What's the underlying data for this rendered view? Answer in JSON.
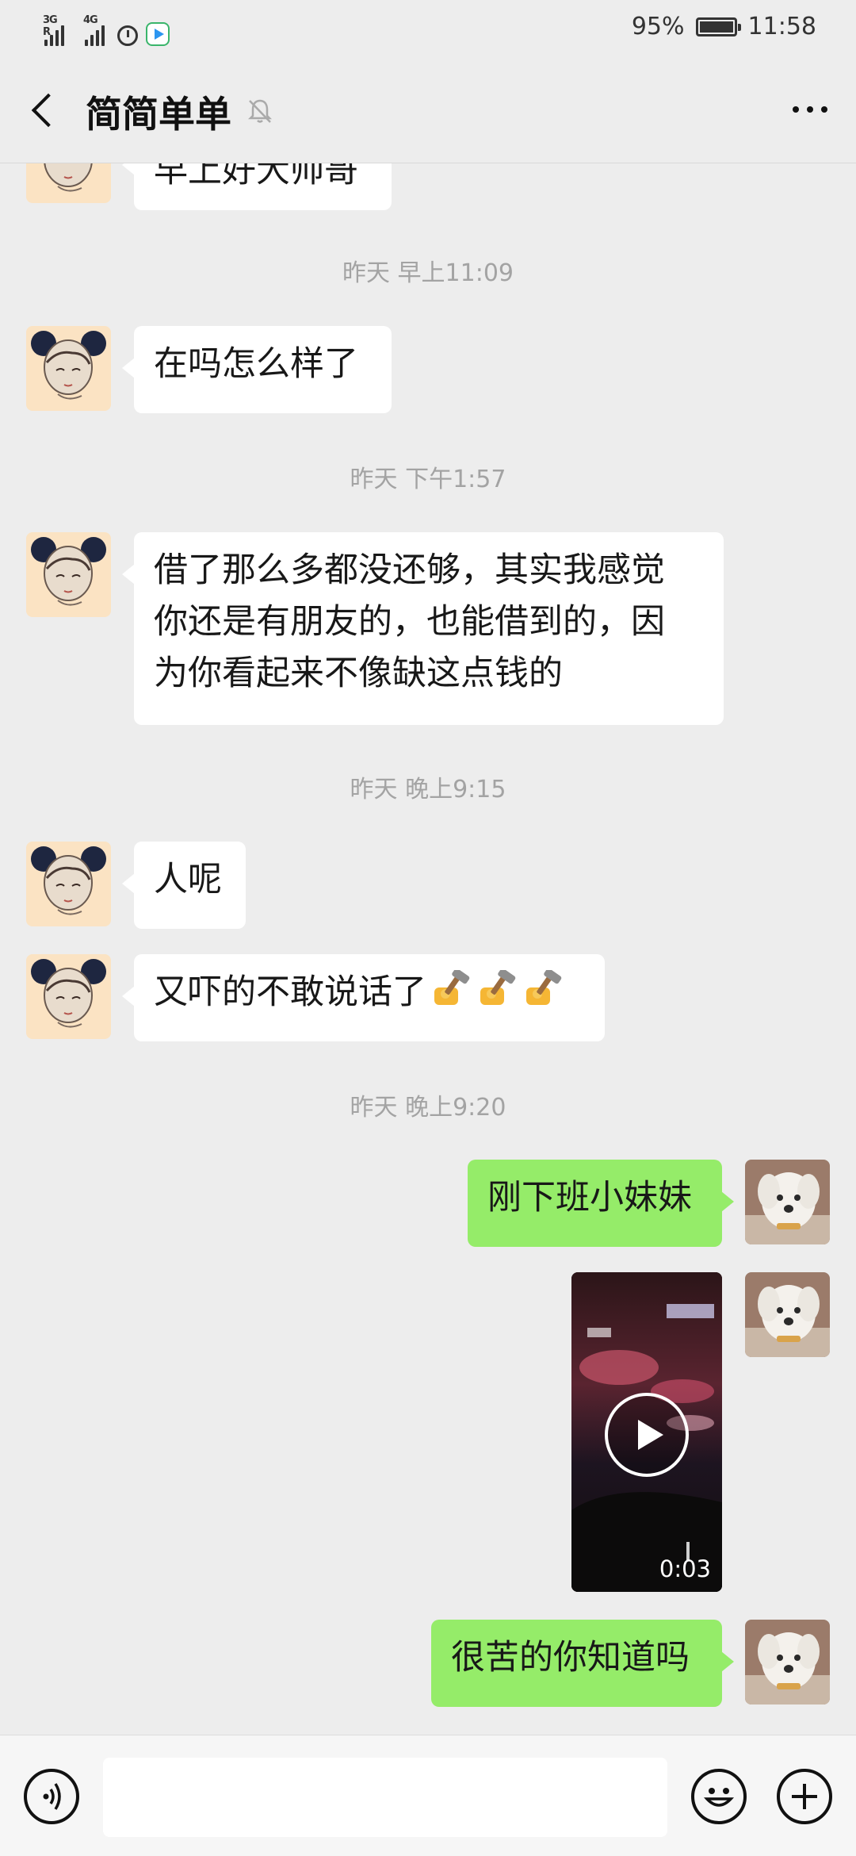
{
  "status_bar": {
    "signal1_tag": "3G R",
    "signal2_tag": "4G",
    "battery_percent": "95%",
    "time": "11:58"
  },
  "header": {
    "title": "简简单单",
    "icons": [
      "back-arrow-icon",
      "mute-bell-icon",
      "more-dots-icon"
    ]
  },
  "messages": {
    "m0": "早上好大帅哥",
    "t1": "昨天 早上11:09",
    "m1": "在吗怎么样了",
    "t2": "昨天 下午1:57",
    "m2_line1": "借了那么多都没还够，其实我感觉",
    "m2_line2": "你还是有朋友的，也能借到的，因",
    "m2_line3": "为你看起来不像缺这点钱的",
    "t3": "昨天 晚上9:15",
    "m3": "人呢",
    "m4": "又吓的不敢说话了",
    "m4_emoji": [
      "hammer-emoji",
      "hammer-emoji",
      "hammer-emoji"
    ],
    "t4": "昨天 晚上9:20",
    "m5": "刚下班小妹妹",
    "video_duration": "0:03",
    "m6": "很苦的你知道吗"
  },
  "input_bar": {
    "placeholder": "",
    "icons": [
      "voice-icon",
      "emoji-icon",
      "plus-icon"
    ]
  }
}
